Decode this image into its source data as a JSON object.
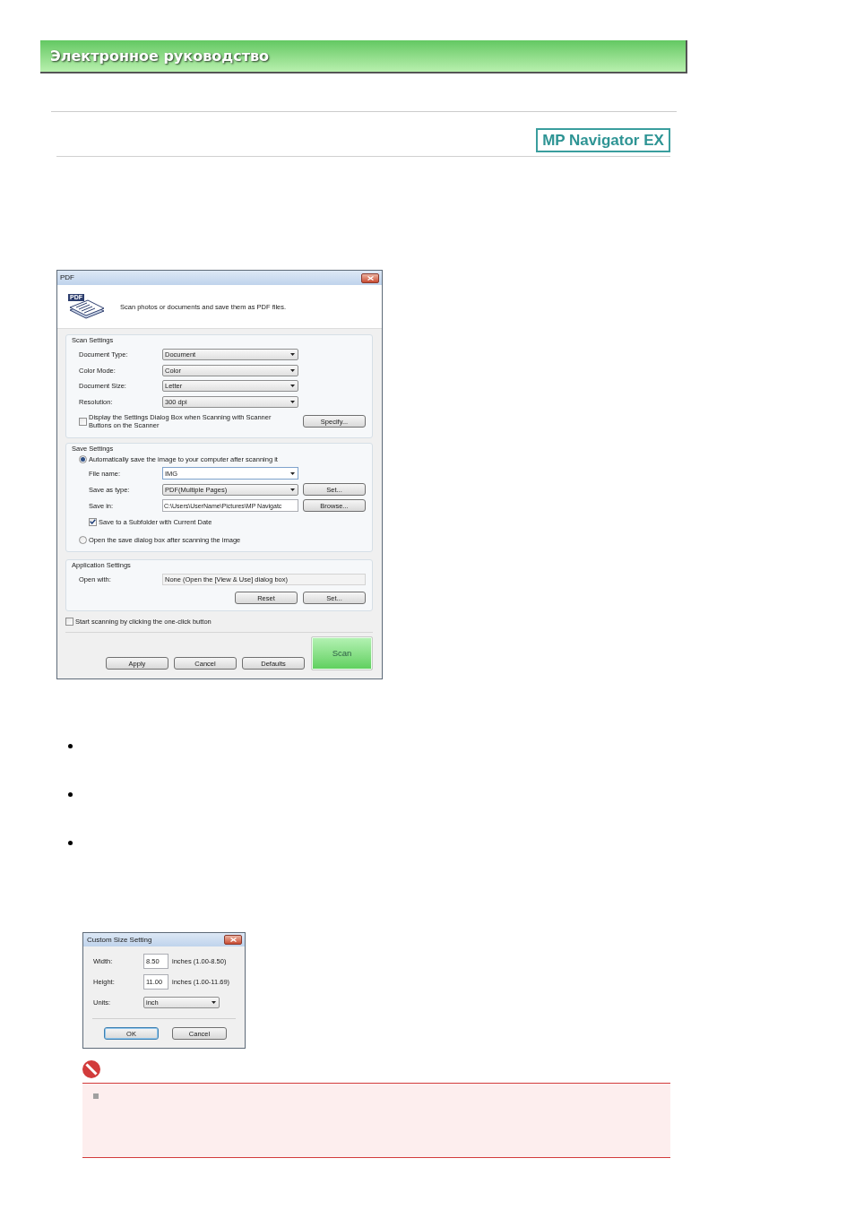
{
  "header": {
    "title": "Электронное руководство"
  },
  "product_badge": "MP Navigator EX",
  "pdf_dialog": {
    "title": "PDF",
    "icon_tag": "PDF",
    "description": "Scan photos or documents and save them as PDF files.",
    "scan_settings": {
      "label": "Scan Settings",
      "fields": [
        {
          "label": "Document Type:",
          "value": "Document"
        },
        {
          "label": "Color Mode:",
          "value": "Color"
        },
        {
          "label": "Document Size:",
          "value": "Letter"
        },
        {
          "label": "Resolution:",
          "value": "300 dpi"
        }
      ],
      "display_dialog": {
        "label": "Display the Settings Dialog Box when Scanning with Scanner\nButtons on the Scanner",
        "checked": false
      },
      "specify_button": "Specify..."
    },
    "save_settings": {
      "label": "Save Settings",
      "options": [
        {
          "label": "Automatically save the image to your computer after scanning it",
          "selected": true
        },
        {
          "label": "Open the save dialog box after scanning the image",
          "selected": false
        }
      ],
      "file_name": {
        "label": "File name:",
        "value": "IMG"
      },
      "save_as_type": {
        "label": "Save as type:",
        "value": "PDF(Multiple Pages)",
        "button": "Set..."
      },
      "save_in": {
        "label": "Save in:",
        "value": "C:\\Users\\UserName\\Pictures\\MP Navigatc",
        "button": "Browse..."
      },
      "subfolder": {
        "label": "Save to a Subfolder with Current Date",
        "checked": true
      }
    },
    "application_settings": {
      "label": "Application Settings",
      "open_with": {
        "label": "Open with:",
        "value": "None (Open the [View & Use] dialog box)"
      },
      "buttons": [
        "Reset",
        "Set..."
      ]
    },
    "one_click": {
      "label": "Start scanning by clicking the one-click button",
      "checked": false
    },
    "buttons": [
      "Apply",
      "Cancel",
      "Defaults"
    ],
    "scan_button": "Scan"
  },
  "custom_size_dialog": {
    "title": "Custom Size Setting",
    "fields": [
      {
        "label": "Width:",
        "value": "8.50",
        "range": "inches (1.00-8.50)"
      },
      {
        "label": "Height:",
        "value": "11.00",
        "range": "inches (1.00-11.69)"
      }
    ],
    "units": {
      "label": "Units:",
      "value": "inch"
    },
    "buttons": [
      {
        "label": "OK",
        "default": true
      },
      {
        "label": "Cancel",
        "default": false
      }
    ]
  }
}
